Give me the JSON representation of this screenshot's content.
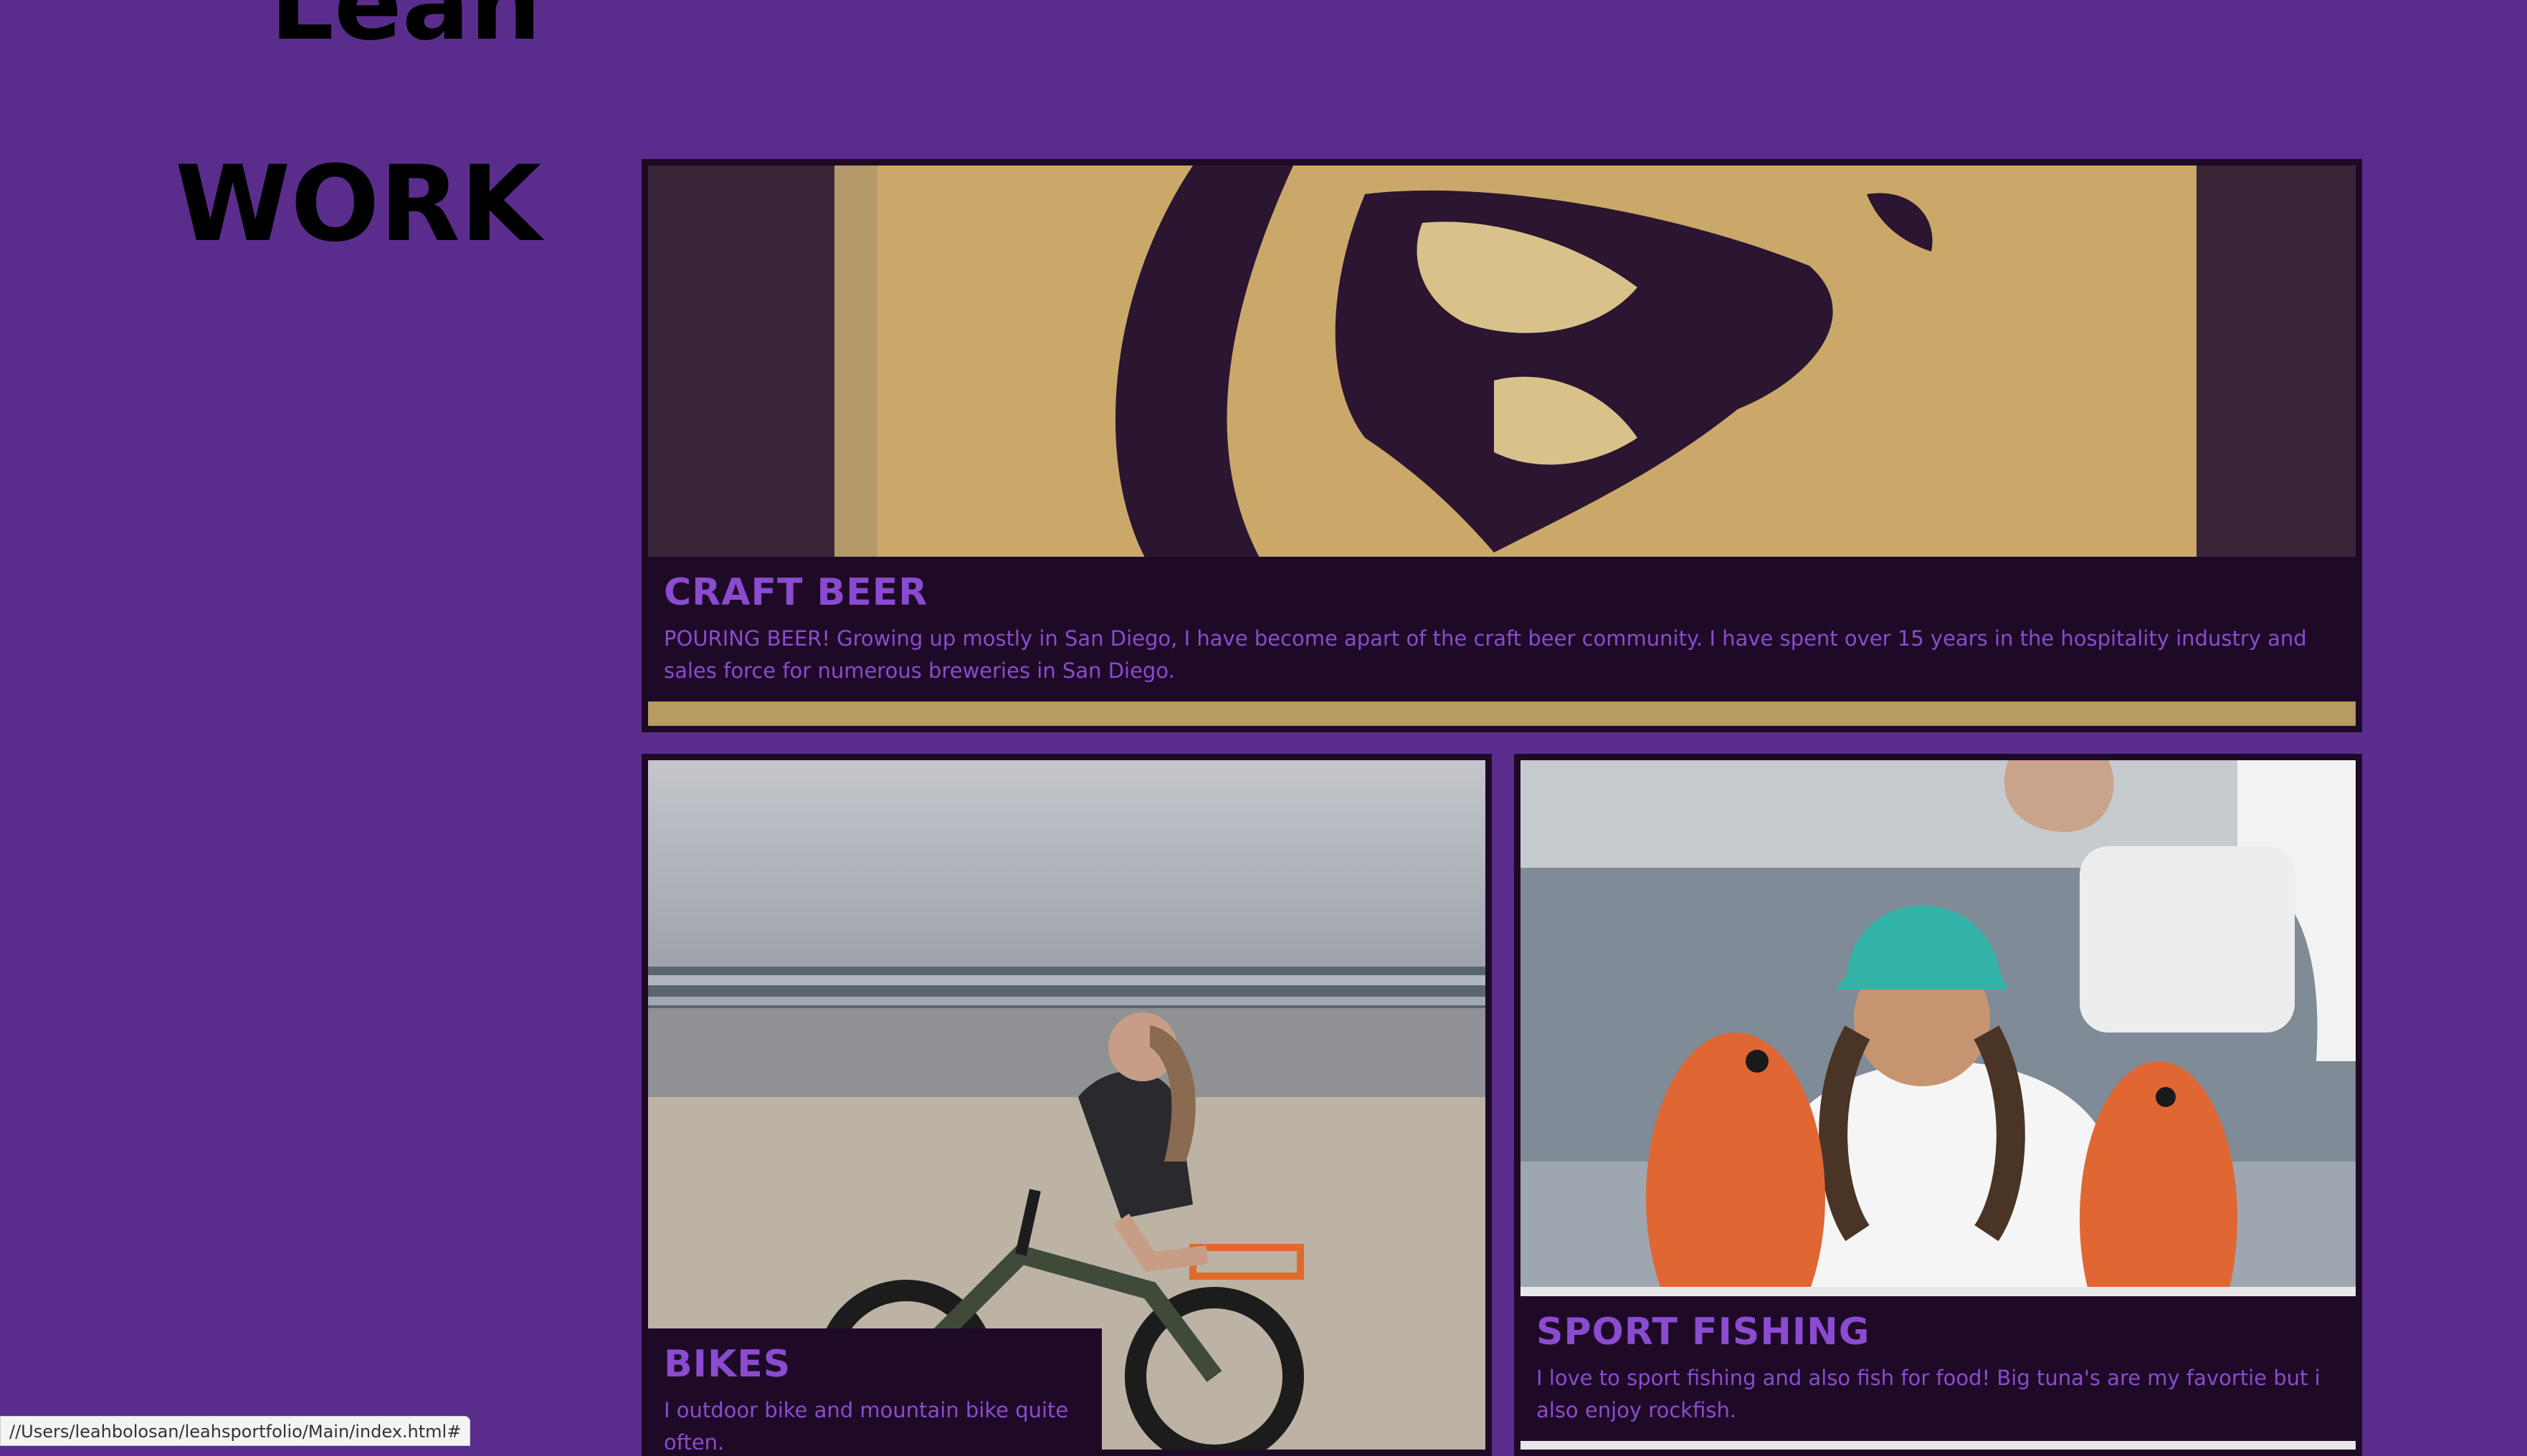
{
  "header": {
    "name": "Leah",
    "section_title": "WORK"
  },
  "cards": [
    {
      "title": "CRAFT BEER",
      "description": "POURING BEER! Growing up mostly in San Diego, I have become apart of the craft beer community. I have spent over 15 years in the hospitality industry and sales force for numerous breweries in San Diego."
    },
    {
      "title": "BIKES",
      "description": "I outdoor bike and mountain bike quite often."
    },
    {
      "title": "SPORT FISHING",
      "description": "I love to sport fishing and also fish for food! Big tuna's are my favortie but i also enjoy rockfish."
    }
  ],
  "status_bar": {
    "url": "//Users/leahbolosan/leahsportfolio/Main/index.html#"
  },
  "colors": {
    "background": "#5a2d8c",
    "card": "#1e0a26",
    "accent": "#8a4bd0"
  }
}
